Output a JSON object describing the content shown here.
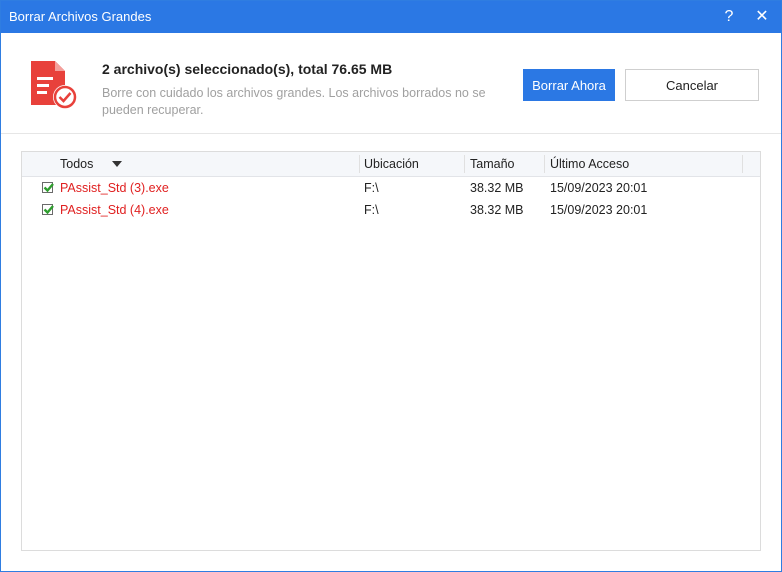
{
  "window": {
    "title": "Borrar Archivos Grandes",
    "help_label": "?",
    "close_label": "✕"
  },
  "header": {
    "icon": "file-delete-icon",
    "headline": "2 archivo(s) seleccionado(s), total 76.65 MB",
    "description": "Borre con cuidado los archivos grandes. Los archivos borrados no se pueden recuperar.",
    "primary_button": "Borrar Ahora",
    "secondary_button": "Cancelar"
  },
  "table": {
    "columns": [
      "Todos",
      "Ubicación",
      "Tamaño",
      "Último Acceso"
    ],
    "rows": [
      {
        "checked": true,
        "name": "PAssist_Std (3).exe",
        "location": "F:\\",
        "size": "38.32 MB",
        "last_access": "15/09/2023 20:01"
      },
      {
        "checked": true,
        "name": "PAssist_Std (4).exe",
        "location": "F:\\",
        "size": "38.32 MB",
        "last_access": "15/09/2023 20:01"
      }
    ]
  },
  "colors": {
    "accent": "#2b78e4",
    "file_name": "#e02020",
    "icon_red": "#e8413b",
    "check_green": "#2e9e2e"
  }
}
